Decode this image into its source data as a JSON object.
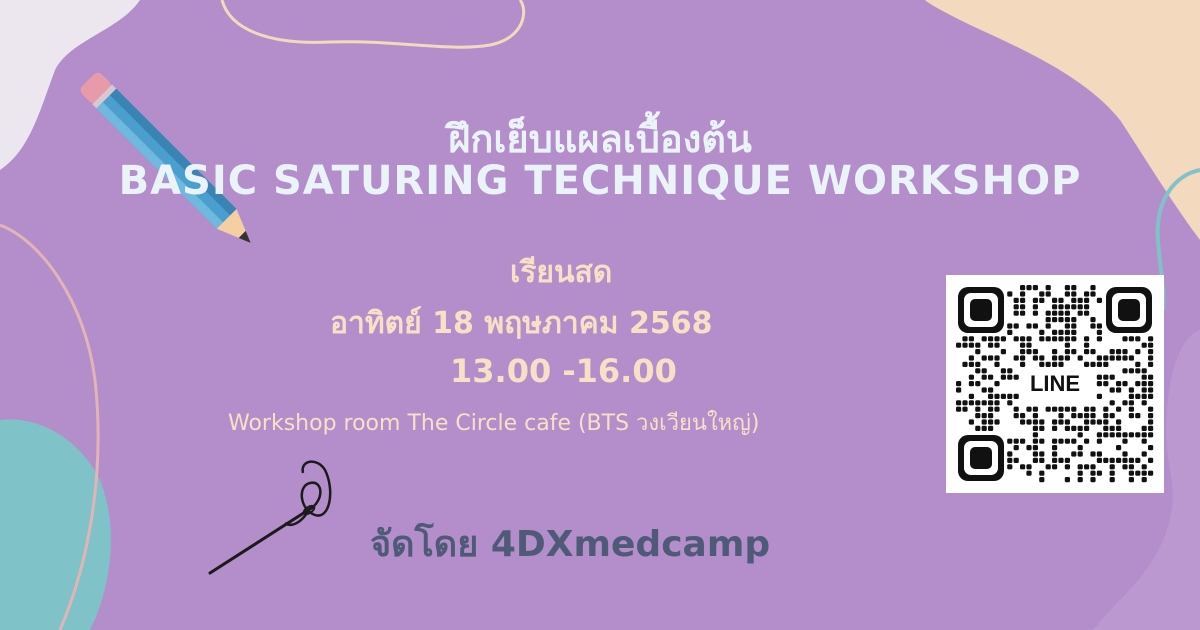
{
  "poster": {
    "title_th": "ฝึกเย็บแผลเบื้องต้น",
    "title_en": "BASIC SATURING TECHNIQUE WORKSHOP",
    "mode": "เรียนสด",
    "date": "อาทิตย์ 18 พฤษภาคม 2568",
    "time": "13.00 -16.00",
    "venue": "Workshop room The Circle cafe (BTS วงเวียนใหญ่)",
    "organizer": "จัดโดย 4DXmedcamp"
  },
  "qr": {
    "label": "LINE"
  },
  "icons": {
    "pencil": "pencil-icon",
    "needle": "needle-thread-icon",
    "qr": "qr-code-icon"
  },
  "colors": {
    "background": "#b48dcb",
    "title": "#eaf3f8",
    "detail_text": "#f6e1c7",
    "organizer_text": "#4f5a78",
    "teal_blob": "#7fc2c8",
    "peach_blob": "#f3d9bd"
  }
}
